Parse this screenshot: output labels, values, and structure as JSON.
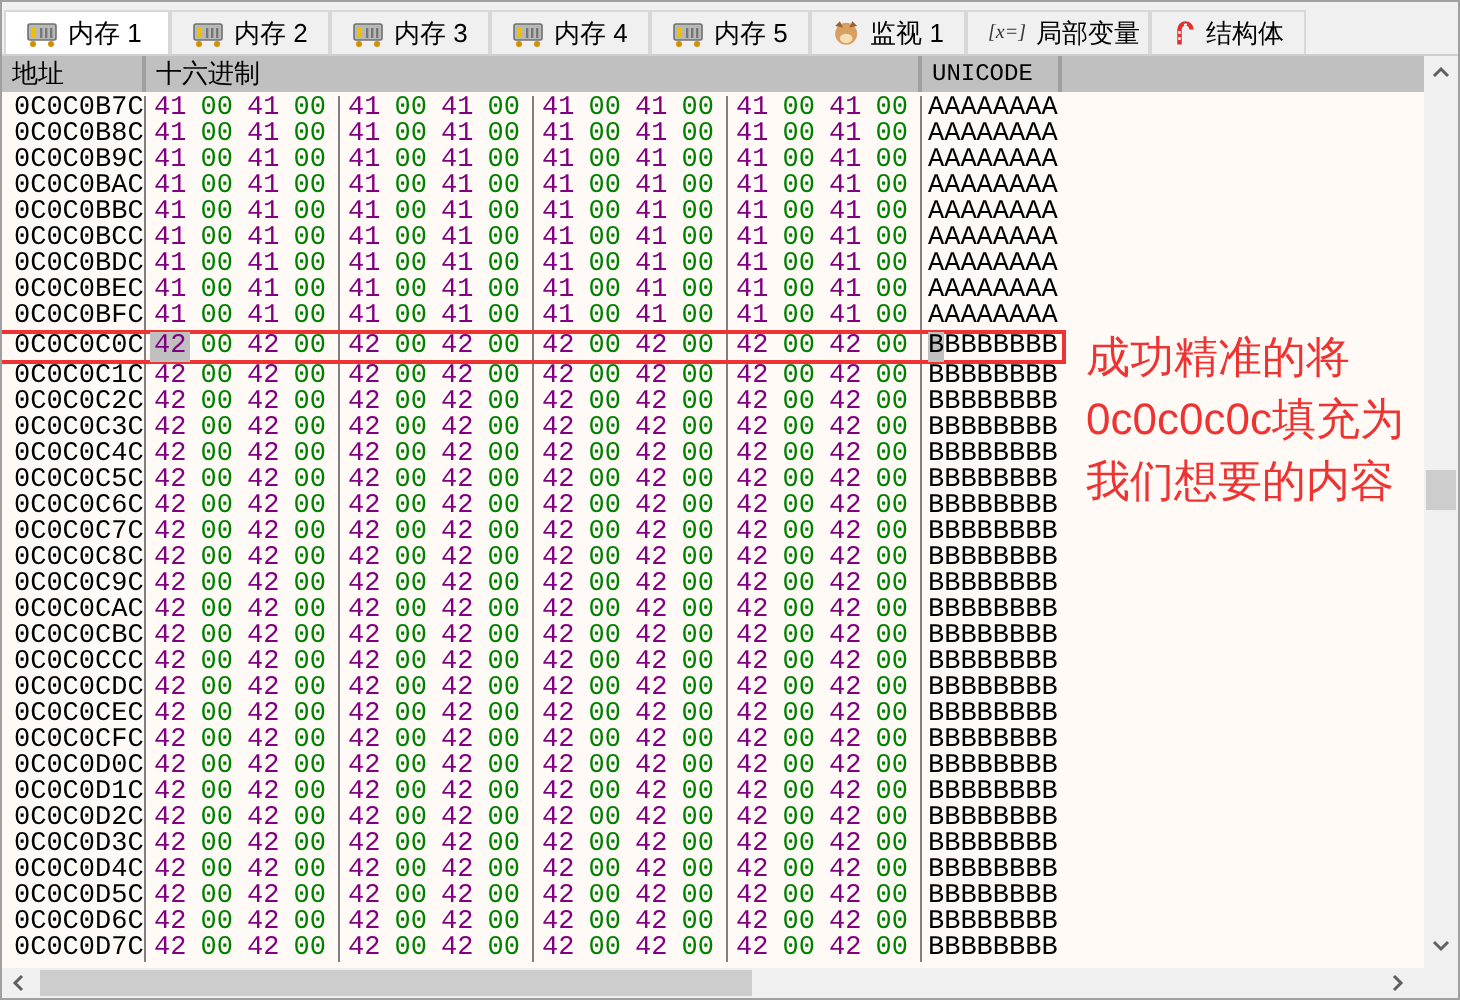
{
  "tabs": [
    {
      "label": "内存 1",
      "kind": "memory",
      "selected": true
    },
    {
      "label": "内存 2",
      "kind": "memory",
      "selected": false
    },
    {
      "label": "内存 3",
      "kind": "memory",
      "selected": false
    },
    {
      "label": "内存 4",
      "kind": "memory",
      "selected": false
    },
    {
      "label": "内存 5",
      "kind": "memory",
      "selected": false
    },
    {
      "label": "监视 1",
      "kind": "watch",
      "selected": false
    },
    {
      "label": "局部变量",
      "kind": "variables",
      "icon_text": "[x=]",
      "selected": false
    },
    {
      "label": "结构体",
      "kind": "struct",
      "selected": false
    }
  ],
  "columns": [
    "地址",
    "十六进制",
    "UNICODE"
  ],
  "rows": [
    {
      "address": "0C0C0B7C",
      "bytes": [
        "41",
        "00",
        "41",
        "00",
        "41",
        "00",
        "41",
        "00",
        "41",
        "00",
        "41",
        "00",
        "41",
        "00",
        "41",
        "00"
      ],
      "unicode": "AAAAAAAA",
      "highlighted": false,
      "cursor": false
    },
    {
      "address": "0C0C0B8C",
      "bytes": [
        "41",
        "00",
        "41",
        "00",
        "41",
        "00",
        "41",
        "00",
        "41",
        "00",
        "41",
        "00",
        "41",
        "00",
        "41",
        "00"
      ],
      "unicode": "AAAAAAAA",
      "highlighted": false,
      "cursor": false
    },
    {
      "address": "0C0C0B9C",
      "bytes": [
        "41",
        "00",
        "41",
        "00",
        "41",
        "00",
        "41",
        "00",
        "41",
        "00",
        "41",
        "00",
        "41",
        "00",
        "41",
        "00"
      ],
      "unicode": "AAAAAAAA",
      "highlighted": false,
      "cursor": false
    },
    {
      "address": "0C0C0BAC",
      "bytes": [
        "41",
        "00",
        "41",
        "00",
        "41",
        "00",
        "41",
        "00",
        "41",
        "00",
        "41",
        "00",
        "41",
        "00",
        "41",
        "00"
      ],
      "unicode": "AAAAAAAA",
      "highlighted": false,
      "cursor": false
    },
    {
      "address": "0C0C0BBC",
      "bytes": [
        "41",
        "00",
        "41",
        "00",
        "41",
        "00",
        "41",
        "00",
        "41",
        "00",
        "41",
        "00",
        "41",
        "00",
        "41",
        "00"
      ],
      "unicode": "AAAAAAAA",
      "highlighted": false,
      "cursor": false
    },
    {
      "address": "0C0C0BCC",
      "bytes": [
        "41",
        "00",
        "41",
        "00",
        "41",
        "00",
        "41",
        "00",
        "41",
        "00",
        "41",
        "00",
        "41",
        "00",
        "41",
        "00"
      ],
      "unicode": "AAAAAAAA",
      "highlighted": false,
      "cursor": false
    },
    {
      "address": "0C0C0BDC",
      "bytes": [
        "41",
        "00",
        "41",
        "00",
        "41",
        "00",
        "41",
        "00",
        "41",
        "00",
        "41",
        "00",
        "41",
        "00",
        "41",
        "00"
      ],
      "unicode": "AAAAAAAA",
      "highlighted": false,
      "cursor": false
    },
    {
      "address": "0C0C0BEC",
      "bytes": [
        "41",
        "00",
        "41",
        "00",
        "41",
        "00",
        "41",
        "00",
        "41",
        "00",
        "41",
        "00",
        "41",
        "00",
        "41",
        "00"
      ],
      "unicode": "AAAAAAAA",
      "highlighted": false,
      "cursor": false
    },
    {
      "address": "0C0C0BFC",
      "bytes": [
        "41",
        "00",
        "41",
        "00",
        "41",
        "00",
        "41",
        "00",
        "41",
        "00",
        "41",
        "00",
        "41",
        "00",
        "41",
        "00"
      ],
      "unicode": "AAAAAAAA",
      "highlighted": false,
      "cursor": false
    },
    {
      "address": "0C0C0C0C",
      "bytes": [
        "42",
        "00",
        "42",
        "00",
        "42",
        "00",
        "42",
        "00",
        "42",
        "00",
        "42",
        "00",
        "42",
        "00",
        "42",
        "00"
      ],
      "unicode": "BBBBBBBB",
      "highlighted": true,
      "cursor": true
    },
    {
      "address": "0C0C0C1C",
      "bytes": [
        "42",
        "00",
        "42",
        "00",
        "42",
        "00",
        "42",
        "00",
        "42",
        "00",
        "42",
        "00",
        "42",
        "00",
        "42",
        "00"
      ],
      "unicode": "BBBBBBBB",
      "highlighted": false,
      "cursor": false
    },
    {
      "address": "0C0C0C2C",
      "bytes": [
        "42",
        "00",
        "42",
        "00",
        "42",
        "00",
        "42",
        "00",
        "42",
        "00",
        "42",
        "00",
        "42",
        "00",
        "42",
        "00"
      ],
      "unicode": "BBBBBBBB",
      "highlighted": false,
      "cursor": false
    },
    {
      "address": "0C0C0C3C",
      "bytes": [
        "42",
        "00",
        "42",
        "00",
        "42",
        "00",
        "42",
        "00",
        "42",
        "00",
        "42",
        "00",
        "42",
        "00",
        "42",
        "00"
      ],
      "unicode": "BBBBBBBB",
      "highlighted": false,
      "cursor": false
    },
    {
      "address": "0C0C0C4C",
      "bytes": [
        "42",
        "00",
        "42",
        "00",
        "42",
        "00",
        "42",
        "00",
        "42",
        "00",
        "42",
        "00",
        "42",
        "00",
        "42",
        "00"
      ],
      "unicode": "BBBBBBBB",
      "highlighted": false,
      "cursor": false
    },
    {
      "address": "0C0C0C5C",
      "bytes": [
        "42",
        "00",
        "42",
        "00",
        "42",
        "00",
        "42",
        "00",
        "42",
        "00",
        "42",
        "00",
        "42",
        "00",
        "42",
        "00"
      ],
      "unicode": "BBBBBBBB",
      "highlighted": false,
      "cursor": false
    },
    {
      "address": "0C0C0C6C",
      "bytes": [
        "42",
        "00",
        "42",
        "00",
        "42",
        "00",
        "42",
        "00",
        "42",
        "00",
        "42",
        "00",
        "42",
        "00",
        "42",
        "00"
      ],
      "unicode": "BBBBBBBB",
      "highlighted": false,
      "cursor": false
    },
    {
      "address": "0C0C0C7C",
      "bytes": [
        "42",
        "00",
        "42",
        "00",
        "42",
        "00",
        "42",
        "00",
        "42",
        "00",
        "42",
        "00",
        "42",
        "00",
        "42",
        "00"
      ],
      "unicode": "BBBBBBBB",
      "highlighted": false,
      "cursor": false
    },
    {
      "address": "0C0C0C8C",
      "bytes": [
        "42",
        "00",
        "42",
        "00",
        "42",
        "00",
        "42",
        "00",
        "42",
        "00",
        "42",
        "00",
        "42",
        "00",
        "42",
        "00"
      ],
      "unicode": "BBBBBBBB",
      "highlighted": false,
      "cursor": false
    },
    {
      "address": "0C0C0C9C",
      "bytes": [
        "42",
        "00",
        "42",
        "00",
        "42",
        "00",
        "42",
        "00",
        "42",
        "00",
        "42",
        "00",
        "42",
        "00",
        "42",
        "00"
      ],
      "unicode": "BBBBBBBB",
      "highlighted": false,
      "cursor": false
    },
    {
      "address": "0C0C0CAC",
      "bytes": [
        "42",
        "00",
        "42",
        "00",
        "42",
        "00",
        "42",
        "00",
        "42",
        "00",
        "42",
        "00",
        "42",
        "00",
        "42",
        "00"
      ],
      "unicode": "BBBBBBBB",
      "highlighted": false,
      "cursor": false
    },
    {
      "address": "0C0C0CBC",
      "bytes": [
        "42",
        "00",
        "42",
        "00",
        "42",
        "00",
        "42",
        "00",
        "42",
        "00",
        "42",
        "00",
        "42",
        "00",
        "42",
        "00"
      ],
      "unicode": "BBBBBBBB",
      "highlighted": false,
      "cursor": false
    },
    {
      "address": "0C0C0CCC",
      "bytes": [
        "42",
        "00",
        "42",
        "00",
        "42",
        "00",
        "42",
        "00",
        "42",
        "00",
        "42",
        "00",
        "42",
        "00",
        "42",
        "00"
      ],
      "unicode": "BBBBBBBB",
      "highlighted": false,
      "cursor": false
    },
    {
      "address": "0C0C0CDC",
      "bytes": [
        "42",
        "00",
        "42",
        "00",
        "42",
        "00",
        "42",
        "00",
        "42",
        "00",
        "42",
        "00",
        "42",
        "00",
        "42",
        "00"
      ],
      "unicode": "BBBBBBBB",
      "highlighted": false,
      "cursor": false
    },
    {
      "address": "0C0C0CEC",
      "bytes": [
        "42",
        "00",
        "42",
        "00",
        "42",
        "00",
        "42",
        "00",
        "42",
        "00",
        "42",
        "00",
        "42",
        "00",
        "42",
        "00"
      ],
      "unicode": "BBBBBBBB",
      "highlighted": false,
      "cursor": false
    },
    {
      "address": "0C0C0CFC",
      "bytes": [
        "42",
        "00",
        "42",
        "00",
        "42",
        "00",
        "42",
        "00",
        "42",
        "00",
        "42",
        "00",
        "42",
        "00",
        "42",
        "00"
      ],
      "unicode": "BBBBBBBB",
      "highlighted": false,
      "cursor": false
    },
    {
      "address": "0C0C0D0C",
      "bytes": [
        "42",
        "00",
        "42",
        "00",
        "42",
        "00",
        "42",
        "00",
        "42",
        "00",
        "42",
        "00",
        "42",
        "00",
        "42",
        "00"
      ],
      "unicode": "BBBBBBBB",
      "highlighted": false,
      "cursor": false
    },
    {
      "address": "0C0C0D1C",
      "bytes": [
        "42",
        "00",
        "42",
        "00",
        "42",
        "00",
        "42",
        "00",
        "42",
        "00",
        "42",
        "00",
        "42",
        "00",
        "42",
        "00"
      ],
      "unicode": "BBBBBBBB",
      "highlighted": false,
      "cursor": false
    },
    {
      "address": "0C0C0D2C",
      "bytes": [
        "42",
        "00",
        "42",
        "00",
        "42",
        "00",
        "42",
        "00",
        "42",
        "00",
        "42",
        "00",
        "42",
        "00",
        "42",
        "00"
      ],
      "unicode": "BBBBBBBB",
      "highlighted": false,
      "cursor": false
    },
    {
      "address": "0C0C0D3C",
      "bytes": [
        "42",
        "00",
        "42",
        "00",
        "42",
        "00",
        "42",
        "00",
        "42",
        "00",
        "42",
        "00",
        "42",
        "00",
        "42",
        "00"
      ],
      "unicode": "BBBBBBBB",
      "highlighted": false,
      "cursor": false
    },
    {
      "address": "0C0C0D4C",
      "bytes": [
        "42",
        "00",
        "42",
        "00",
        "42",
        "00",
        "42",
        "00",
        "42",
        "00",
        "42",
        "00",
        "42",
        "00",
        "42",
        "00"
      ],
      "unicode": "BBBBBBBB",
      "highlighted": false,
      "cursor": false
    },
    {
      "address": "0C0C0D5C",
      "bytes": [
        "42",
        "00",
        "42",
        "00",
        "42",
        "00",
        "42",
        "00",
        "42",
        "00",
        "42",
        "00",
        "42",
        "00",
        "42",
        "00"
      ],
      "unicode": "BBBBBBBB",
      "highlighted": false,
      "cursor": false
    },
    {
      "address": "0C0C0D6C",
      "bytes": [
        "42",
        "00",
        "42",
        "00",
        "42",
        "00",
        "42",
        "00",
        "42",
        "00",
        "42",
        "00",
        "42",
        "00",
        "42",
        "00"
      ],
      "unicode": "BBBBBBBB",
      "highlighted": false,
      "cursor": false
    },
    {
      "address": "0C0C0D7C",
      "bytes": [
        "42",
        "00",
        "42",
        "00",
        "42",
        "00",
        "42",
        "00",
        "42",
        "00",
        "42",
        "00",
        "42",
        "00",
        "42",
        "00"
      ],
      "unicode": "BBBBBBBB",
      "highlighted": false,
      "cursor": false
    }
  ],
  "annotation": {
    "lines": [
      "成功精准的将",
      "0c0c0c0c填充为",
      "我们想要的内容"
    ]
  }
}
